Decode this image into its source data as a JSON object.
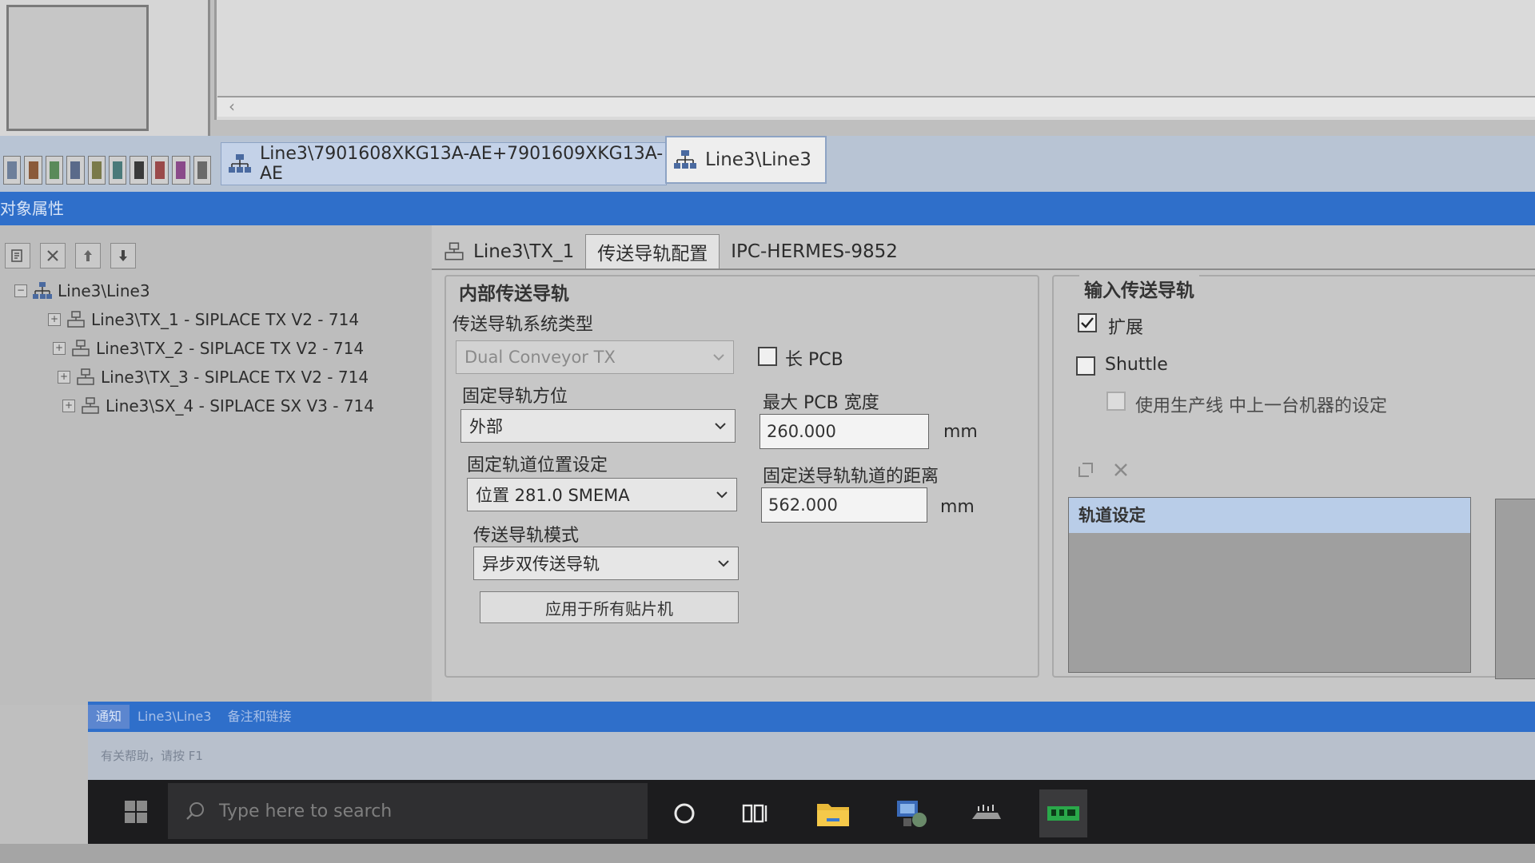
{
  "document_tabs": [
    {
      "label": "Line3\\7901608XKG13A-AE+7901609XKG13A-AE",
      "icon": "line-network-icon",
      "active": false
    },
    {
      "label": "Line3\\Line3",
      "icon": "line-network-icon",
      "active": true
    }
  ],
  "panel_header": {
    "title": "对象属性"
  },
  "tree": {
    "root": "Line3\\Line3",
    "items": [
      "Line3\\TX_1 - SIPLACE TX V2 - 714",
      "Line3\\TX_2 - SIPLACE TX V2 - 714",
      "Line3\\TX_3 - SIPLACE TX V2 - 714",
      "Line3\\SX_4 - SIPLACE SX V3 - 714"
    ]
  },
  "property_tabs": [
    {
      "label": "Line3\\TX_1",
      "icon": "machine-icon",
      "active": false
    },
    {
      "label": "传送导轨配置",
      "active": true
    },
    {
      "label": "IPC-HERMES-9852",
      "active": false
    }
  ],
  "inner_conveyor": {
    "group_title": "内部传送导轨",
    "system_type_label": "传送导轨系统类型",
    "system_type_value": "Dual Conveyor TX",
    "long_pcb_label": "长 PCB",
    "long_pcb_checked": false,
    "fixed_rail_side_label": "固定导轨方位",
    "fixed_rail_side_value": "外部",
    "fixed_track_position_label": "固定轨道位置设定",
    "fixed_track_position_value": "位置 281.0 SMEMA",
    "conveyor_mode_label": "传送导轨模式",
    "conveyor_mode_value": "异步双传送导轨",
    "apply_button": "应用于所有贴片机",
    "max_pcb_width_label": "最大 PCB 宽度",
    "max_pcb_width_value": "260.000",
    "max_pcb_width_unit": "mm",
    "fixed_distance_label": "固定送导轨轨道的距离",
    "fixed_distance_value": "562.000",
    "fixed_distance_unit": "mm"
  },
  "input_conveyor": {
    "group_title": "输入传送导轨",
    "extend_label": "扩展",
    "extend_checked": true,
    "shuttle_label": "Shuttle",
    "shuttle_checked": false,
    "use_previous_label": "使用生产线 中上一台机器的设定",
    "use_previous_checked": false,
    "track_settings_header": "轨道设定"
  },
  "bottom_tabs": [
    {
      "label": "通知",
      "active": true
    },
    {
      "label": "Line3\\Line3",
      "active": false
    },
    {
      "label": "备注和链接",
      "active": false
    }
  ],
  "status_bar": {
    "text": "有关帮助，请按 F1"
  },
  "taskbar": {
    "search_placeholder": "Type here to search",
    "apps": [
      "cortana-icon",
      "task-view-icon",
      "file-explorer-icon",
      "network-app-icon",
      "keyboard-app-icon",
      "green-app-icon"
    ]
  },
  "colors": {
    "header_blue": "#2f6fca",
    "tab_blue": "#c4d2e8",
    "track_header": "#b9cde8",
    "taskbar": "#1c1c1e"
  }
}
